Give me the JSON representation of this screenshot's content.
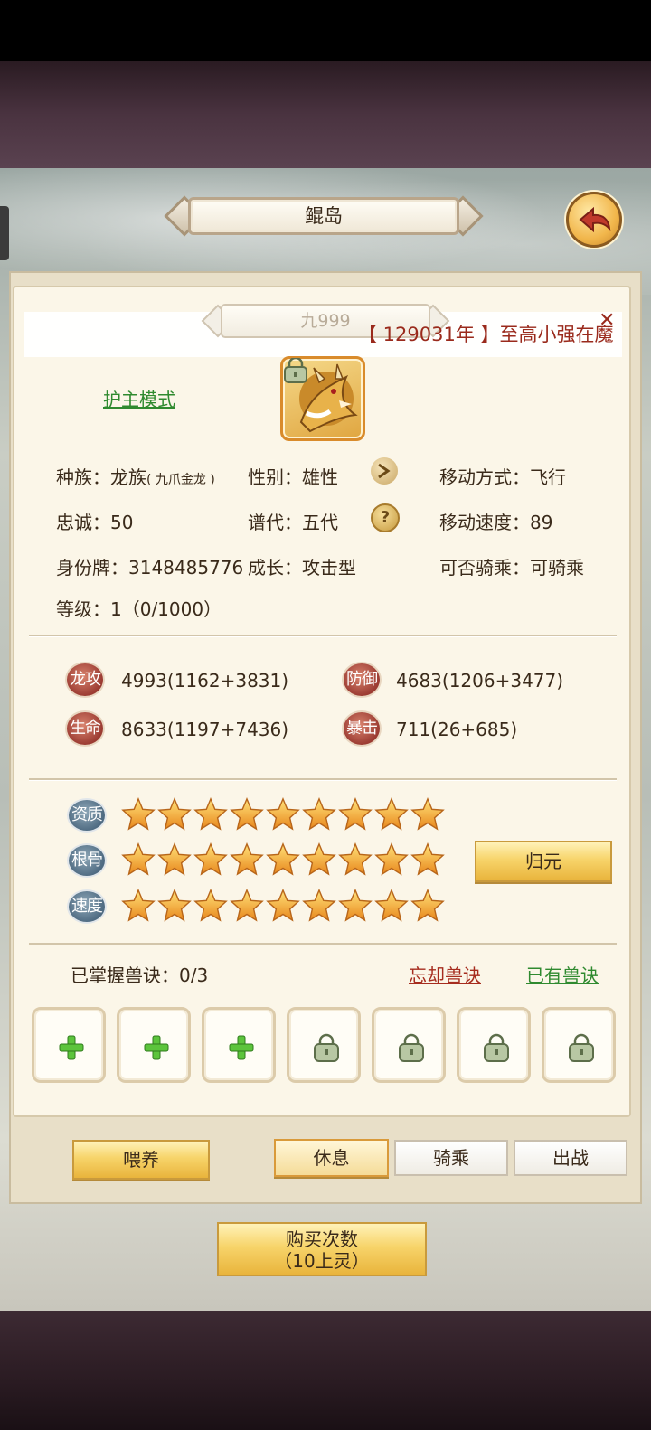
{
  "header": {
    "title": "鲲岛"
  },
  "pet": {
    "name": "九999",
    "owner_line": "【 129031年 】至高小强在魔",
    "mode_link": "护主模式"
  },
  "info": {
    "race_label": "种族：",
    "race_value": "龙族",
    "race_sub": "( 九爪金龙 )",
    "gender": "性别：雄性",
    "move_mode": "移动方式：飞行",
    "loyalty": "忠诚：50",
    "generation": "谱代：五代",
    "move_speed": "移动速度：89",
    "id_tag": "身份牌：3148485776",
    "growth": "成长：攻击型",
    "rideable": "可否骑乘：可骑乘",
    "level": "等级：1（0/1000）"
  },
  "stats": [
    {
      "label": "龙攻",
      "value": "4993(1162+3831)"
    },
    {
      "label": "防御",
      "value": "4683(1206+3477)"
    },
    {
      "label": "生命",
      "value": "8633(1197+7436)"
    },
    {
      "label": "暴击",
      "value": "711(26+685)"
    }
  ],
  "aptitude": [
    {
      "label": "资质",
      "stars": 9
    },
    {
      "label": "根骨",
      "stars": 9
    },
    {
      "label": "速度",
      "stars": 9
    }
  ],
  "buttons": {
    "reset": "归元",
    "feed": "喂养",
    "rest": "休息",
    "ride": "骑乘",
    "battle": "出战",
    "buy_line1": "购买次数",
    "buy_line2": "（10上灵）"
  },
  "skills": {
    "mastered": "已掌握兽诀：0/3",
    "forget": "忘却兽诀",
    "owned": "已有兽诀",
    "slots": [
      "plus",
      "plus",
      "plus",
      "lock",
      "lock",
      "lock",
      "lock"
    ]
  },
  "colors": {
    "accent_gold": "#f7d46a",
    "link_green": "#2f8a2f",
    "link_red": "#a62c1e",
    "owner_red": "#9a2a1c"
  }
}
